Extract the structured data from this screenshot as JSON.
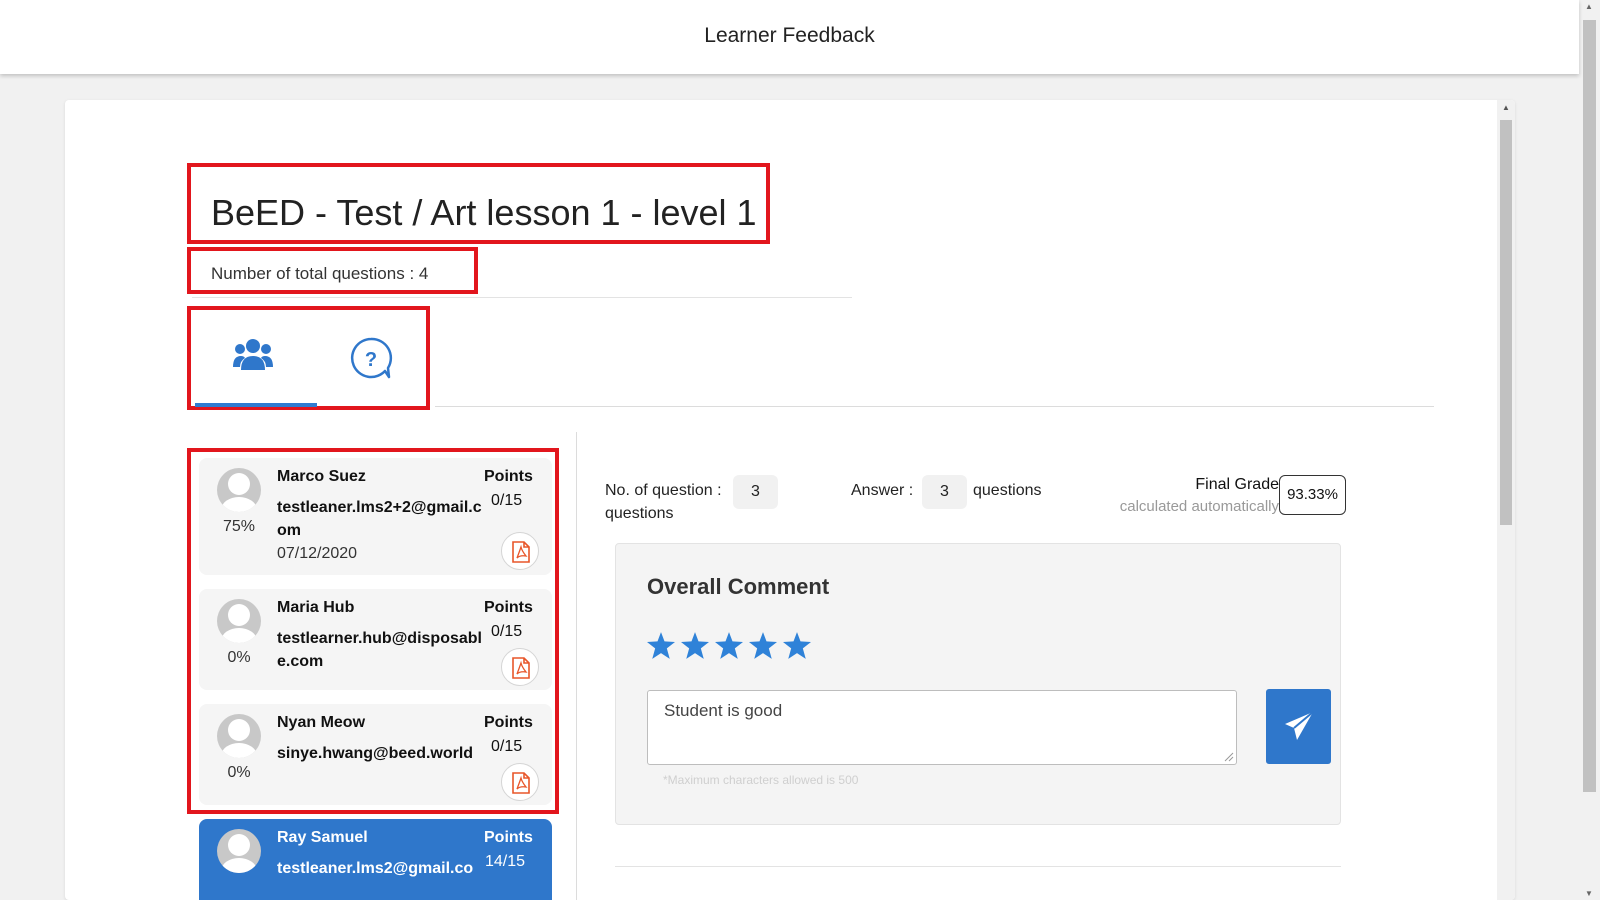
{
  "header": {
    "title": "Learner Feedback"
  },
  "course": {
    "title": "BeED - Test / Art lesson 1 - level 1",
    "total_questions": "Number of total questions : 4"
  },
  "tabs": [
    {
      "icon": "users-icon",
      "active": true
    },
    {
      "icon": "question-chat-icon",
      "active": false
    }
  ],
  "learners": [
    {
      "name": "Marco Suez",
      "email": "testleaner.lms2+2@gmail.com",
      "percent": "75%",
      "date": "07/12/2020",
      "points_label": "Points",
      "points": "0/15",
      "selected": false
    },
    {
      "name": "Maria Hub",
      "email": "testlearner.hub@disposable.com",
      "percent": "0%",
      "points_label": "Points",
      "points": "0/15",
      "selected": false
    },
    {
      "name": "Nyan Meow",
      "email": "sinye.hwang@beed.world",
      "percent": "0%",
      "points_label": "Points",
      "points": "0/15",
      "selected": false
    },
    {
      "name": "Ray Samuel",
      "email": "testleaner.lms2@gmail.co",
      "points_label": "Points",
      "points": "14/15",
      "selected": true
    }
  ],
  "stats": {
    "no_question_label": "No. of question :",
    "no_question_value": "3",
    "no_question_unit": "questions",
    "answer_label": "Answer :",
    "answer_value": "3",
    "answer_unit": "questions"
  },
  "final_grade": {
    "label": "Final Grade",
    "sublabel": "calculated automatically",
    "value": "93.33%"
  },
  "comment": {
    "title": "Overall Comment",
    "rating": 5,
    "rating_max": 5,
    "text": "Student is good",
    "hint": "*Maximum characters allowed is 500"
  },
  "colors": {
    "accent": "#2f77cb",
    "highlight": "#e2161d",
    "pdf": "#e8562a"
  }
}
